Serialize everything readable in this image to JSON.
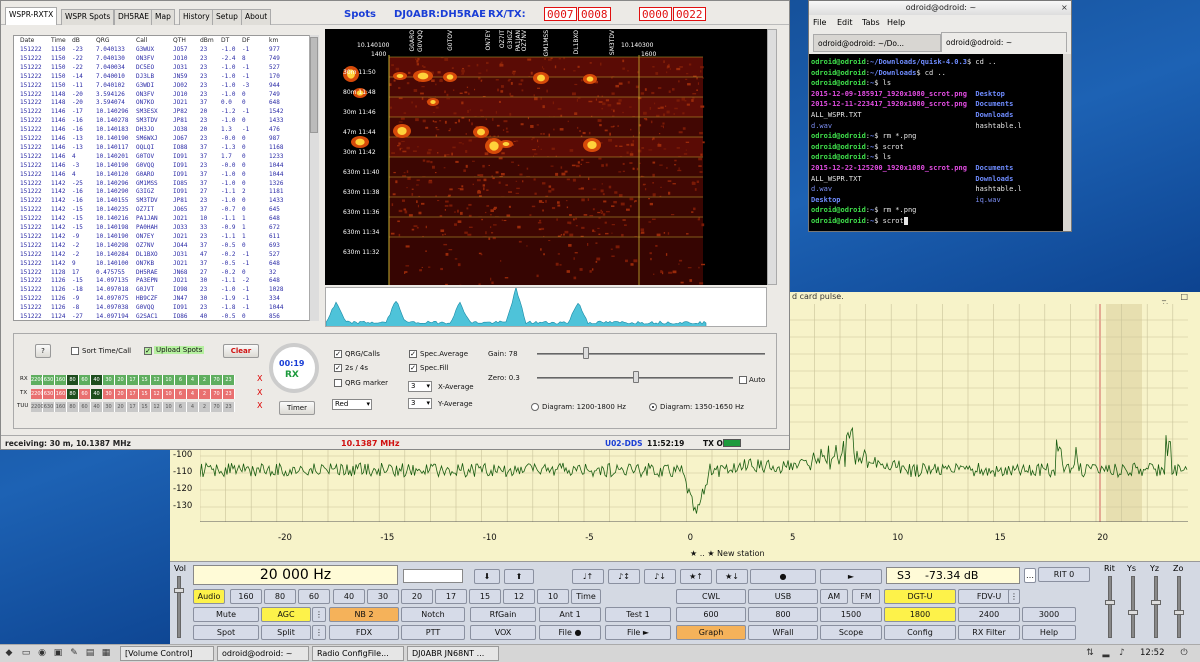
{
  "wspr": {
    "tabs": [
      "WSPR-RXTX",
      "WSPR Spots",
      "DH5RAE",
      "Map",
      "History",
      "Setup",
      "About"
    ],
    "spots_title": "Spots",
    "call_title": "DJ0ABR:DH5RAE",
    "rxtx_label": "RX/TX:",
    "rxtx_counter": [
      "0007",
      "0008"
    ],
    "time_counter": [
      "0000",
      "0022"
    ],
    "table_headers": [
      "Date",
      "Time",
      "dB",
      "QRG",
      "Call",
      "QTH",
      "dBm",
      "DT",
      "DF",
      "km"
    ],
    "rows": [
      [
        "151222",
        "1150",
        "-23",
        "7.040133",
        "G3WUX",
        "JO57",
        "23",
        "-1.0",
        "-1",
        "977"
      ],
      [
        "151222",
        "1150",
        "-22",
        "7.040130",
        "ON3FV",
        "JO10",
        "23",
        "-2.4",
        "8",
        "749"
      ],
      [
        "151222",
        "1150",
        "-22",
        "7.040034",
        "DC5EO",
        "JO31",
        "23",
        "-1.0",
        "-1",
        "527"
      ],
      [
        "151222",
        "1150",
        "-14",
        "7.040010",
        "DJ3LB",
        "JN59",
        "23",
        "-1.0",
        "-1",
        "170"
      ],
      [
        "151222",
        "1150",
        "-11",
        "7.040102",
        "G3WDI",
        "JO02",
        "23",
        "-1.0",
        "-3",
        "944"
      ],
      [
        "151222",
        "1148",
        "-20",
        "3.594126",
        "ON3FV",
        "JO10",
        "23",
        "-1.0",
        "0",
        "749"
      ],
      [
        "151222",
        "1148",
        "-20",
        "3.594074",
        "ON7KO",
        "JO21",
        "37",
        "0.0",
        "0",
        "648"
      ],
      [
        "151222",
        "1146",
        "-17",
        "10.140296",
        "SM3ESX",
        "JP82",
        "20",
        "-1.2",
        "-1",
        "1542"
      ],
      [
        "151222",
        "1146",
        "-16",
        "10.140278",
        "SM3TDV",
        "JP81",
        "23",
        "-1.0",
        "0",
        "1433"
      ],
      [
        "151222",
        "1146",
        "-16",
        "10.140183",
        "DH3JO",
        "JO38",
        "20",
        "1.3",
        "-1",
        "476"
      ],
      [
        "151222",
        "1146",
        "-13",
        "10.140190",
        "SM6WXJ",
        "JO67",
        "23",
        "-0.0",
        "0",
        "987"
      ],
      [
        "151222",
        "1146",
        "-13",
        "10.140117",
        "OQLQI",
        "IO88",
        "37",
        "-1.3",
        "0",
        "1168"
      ],
      [
        "151222",
        "1146",
        "4",
        "10.140201",
        "G0TOV",
        "IO91",
        "37",
        "1.7",
        "0",
        "1233"
      ],
      [
        "151222",
        "1146",
        "-3",
        "10.140190",
        "G0VQQ",
        "IO91",
        "23",
        "-0.0",
        "0",
        "1044"
      ],
      [
        "151222",
        "1146",
        "4",
        "10.140120",
        "G0ARO",
        "IO91",
        "37",
        "-1.0",
        "0",
        "1044"
      ],
      [
        "151222",
        "1142",
        "-25",
        "10.140296",
        "GM1MSS",
        "IO85",
        "37",
        "-1.0",
        "0",
        "1326"
      ],
      [
        "151222",
        "1142",
        "-16",
        "10.140290",
        "G3IGZ",
        "IO91",
        "27",
        "-1.1",
        "2",
        "1181"
      ],
      [
        "151222",
        "1142",
        "-16",
        "10.140155",
        "SM3TDV",
        "JP81",
        "23",
        "-1.0",
        "0",
        "1433"
      ],
      [
        "151222",
        "1142",
        "-15",
        "10.140235",
        "OZ7IT",
        "JO65",
        "37",
        "-0.7",
        "0",
        "645"
      ],
      [
        "151222",
        "1142",
        "-15",
        "10.140216",
        "PA1JAN",
        "JO21",
        "10",
        "-1.1",
        "1",
        "648"
      ],
      [
        "151222",
        "1142",
        "-15",
        "10.140198",
        "PA0HAH",
        "JO33",
        "33",
        "-0.9",
        "1",
        "672"
      ],
      [
        "151222",
        "1142",
        "-9",
        "10.140190",
        "ON7EY",
        "JO21",
        "23",
        "-1.1",
        "1",
        "611"
      ],
      [
        "151222",
        "1142",
        "-2",
        "10.140298",
        "OZ7NV",
        "JO44",
        "37",
        "-0.5",
        "0",
        "693"
      ],
      [
        "151222",
        "1142",
        "-2",
        "10.140284",
        "DL1BXO",
        "JO31",
        "47",
        "-0.2",
        "-1",
        "527"
      ],
      [
        "151222",
        "1142",
        "9",
        "10.140100",
        "ON7KB",
        "JO21",
        "37",
        "-0.5",
        "-1",
        "648"
      ],
      [
        "151222",
        "1128",
        "17",
        "0.475755",
        "DH5RAE",
        "JN68",
        "27",
        "-0.2",
        "0",
        "32"
      ],
      [
        "151222",
        "1126",
        "-15",
        "14.097135",
        "PA3EPN",
        "JO21",
        "30",
        "-1.1",
        "-2",
        "648"
      ],
      [
        "151222",
        "1126",
        "-18",
        "14.097018",
        "G0JVT",
        "IO98",
        "23",
        "-1.0",
        "-1",
        "1028"
      ],
      [
        "151222",
        "1126",
        "-9",
        "14.097075",
        "HB9CZF",
        "JN47",
        "30",
        "-1.9",
        "-1",
        "334"
      ],
      [
        "151222",
        "1126",
        "-8",
        "14.097038",
        "G0VQQ",
        "IO91",
        "23",
        "-1.8",
        "-1",
        "1044"
      ],
      [
        "151222",
        "1124",
        "-27",
        "14.097194",
        "G2SAC1",
        "IO86",
        "40",
        "-0.5",
        "0",
        "856"
      ]
    ],
    "waterfall": {
      "freq_left": "10.140100",
      "freq_left_sub": "1400",
      "freq_right": "10.140300",
      "freq_right_sub": "1600",
      "calls": [
        "G0ARO",
        "G0VQQ",
        "G0TOV",
        "ON7EY",
        "OZ7IT",
        "G3IGZ",
        "PA1JAN",
        "OZ7NV",
        "GM1MSS",
        "DL1BXO",
        "SM3TDV"
      ],
      "time_labels": [
        "30m 11:50",
        "80m 11:48",
        "30m 11:46",
        "47m 11:44",
        "30m 11:42",
        "630m 11:40",
        "630m 11:38",
        "630m 11:36",
        "630m 11:34",
        "630m 11:32"
      ]
    },
    "controls": {
      "help_btn": "?",
      "sort_label": "Sort Time/Call",
      "upload_label": "Upload Spots",
      "clear_btn": "Clear",
      "rx_label": "RX",
      "tx_label": "TX",
      "tuu_label": "TUU",
      "bands": [
        "2200",
        "630",
        "160",
        "80",
        "60",
        "40",
        "30",
        "20",
        "17",
        "15",
        "12",
        "10",
        "6",
        "4",
        "2",
        "70",
        "23"
      ],
      "dial_time": "00:19",
      "dial_mode": "RX",
      "timer_btn": "Timer",
      "qrg_calls": "QRG/Calls",
      "twos_fours": "2s / 4s",
      "qrg_marker": "QRG marker",
      "color_select": "Red",
      "spec_average": "Spec.Average",
      "spec_fill": "Spec.Fill",
      "x_average_val": "3",
      "x_average": "X-Average",
      "y_average_val": "3",
      "y_average": "Y-Average",
      "gain_label": "Gain: 78",
      "zero_label": "Zero: 0.3",
      "auto_label": "Auto",
      "diag1": "Diagram: 1200-1800 Hz",
      "diag2": "Diagram: 1350-1650 Hz"
    },
    "status": {
      "receiving": "receiving: 30 m, 10.1387 MHz",
      "freq": "10.1387 MHz",
      "dds": "U02-DDS",
      "time": "11:52:19",
      "tx": "TX OFF"
    }
  },
  "terminal": {
    "title": "odroid@odroid: ~",
    "menu": [
      "File",
      "Edit",
      "Tabs",
      "Help"
    ],
    "tab1": "odroid@odroid: ~/Do...",
    "tab2": "odroid@odroid: ~",
    "lines": [
      [
        [
          "c-green",
          "odroid@odroid"
        ],
        [
          "c-white",
          ":"
        ],
        [
          "c-blue",
          "~/Downloads/quisk-4.0.3"
        ],
        [
          "c-white",
          "$ cd .."
        ]
      ],
      [
        [
          "c-green",
          "odroid@odroid"
        ],
        [
          "c-white",
          ":"
        ],
        [
          "c-blue",
          "~/Downloads"
        ],
        [
          "c-white",
          "$ cd .."
        ]
      ],
      [
        [
          "c-green",
          "odroid@odroid"
        ],
        [
          "c-white",
          ":"
        ],
        [
          "c-blue",
          "~"
        ],
        [
          "c-white",
          "$ ls"
        ]
      ],
      [
        [
          "c-mag",
          "2015-12-09-185917_1920x1080_scrot.png"
        ],
        [
          "c-blue",
          "  Desktop"
        ]
      ],
      [
        [
          "c-mag",
          "2015-12-11-223417_1920x1080_scrot.png"
        ],
        [
          "c-blue",
          "  Documents"
        ]
      ],
      [
        [
          "c-white",
          "ALL_WSPR.TXT                           "
        ],
        [
          "c-blue",
          "Downloads"
        ]
      ],
      [
        [
          "c-lblue",
          "d.wav                                  "
        ],
        [
          "c-white",
          "hashtable.l"
        ]
      ],
      [
        [
          "c-green",
          "odroid@odroid"
        ],
        [
          "c-white",
          ":"
        ],
        [
          "c-blue",
          "~"
        ],
        [
          "c-white",
          "$ rm *.png"
        ]
      ],
      [
        [
          "c-green",
          "odroid@odroid"
        ],
        [
          "c-white",
          ":"
        ],
        [
          "c-blue",
          "~"
        ],
        [
          "c-white",
          "$ scrot"
        ]
      ],
      [
        [
          "c-green",
          "odroid@odroid"
        ],
        [
          "c-white",
          ":"
        ],
        [
          "c-blue",
          "~"
        ],
        [
          "c-white",
          "$ ls"
        ]
      ],
      [
        [
          "c-mag",
          "2015-12-22-125200_1920x1080_scrot.png"
        ],
        [
          "c-blue",
          "  Documents"
        ]
      ],
      [
        [
          "c-white",
          "ALL_WSPR.TXT                           "
        ],
        [
          "c-blue",
          "Downloads"
        ]
      ],
      [
        [
          "c-lblue",
          "d.wav                                  "
        ],
        [
          "c-white",
          "hashtable.l"
        ]
      ],
      [
        [
          "c-blue",
          "Desktop                                "
        ],
        [
          "c-lblue",
          "iq.wav"
        ]
      ],
      [
        [
          "c-green",
          "odroid@odroid"
        ],
        [
          "c-white",
          ":"
        ],
        [
          "c-blue",
          "~"
        ],
        [
          "c-white",
          "$ rm *.png"
        ]
      ],
      [
        [
          "c-green",
          "odroid@odroid"
        ],
        [
          "c-white",
          ":"
        ],
        [
          "c-blue",
          "~"
        ],
        [
          "c-white",
          "$ scrot"
        ]
      ]
    ]
  },
  "quisk": {
    "title": "d card pulse.",
    "window_controls": "_ □ ×",
    "y_labels": [
      "-100",
      "-110",
      "-120",
      "-130"
    ],
    "x_labels": [
      "-20",
      "-15",
      "-10",
      "-5",
      "0",
      "5",
      "10",
      "15",
      "20"
    ],
    "new_station": "★ ..  ★ New station",
    "vol_label": "Vol",
    "freq_display": "20 000 Hz",
    "smeter": "S3    -73.34 dB",
    "rit": "RIT 0",
    "row1": [
      "Audio",
      "160",
      "80",
      "60",
      "40",
      "30",
      "20",
      "17",
      "15",
      "12",
      "10",
      "Time"
    ],
    "row1_ctrl": [
      "♩↑",
      "♪↕",
      "♪↓",
      "★↑",
      "★↓",
      "●",
      "►"
    ],
    "row1_right": [
      "CWL",
      "USB",
      "AM",
      "FM",
      "DGT-U",
      "FDV-U"
    ],
    "row2": [
      "Mute",
      "AGC",
      "NB 2",
      "Notch",
      "RfGain",
      "Ant 1",
      "Test 1",
      "600",
      "800",
      "1500",
      "1800",
      "2400",
      "3000"
    ],
    "row3": [
      "Spot",
      "Split",
      "FDX",
      "PTT",
      "VOX",
      "File ●",
      "File ►",
      "Graph",
      "WFall",
      "Scope",
      "Config",
      "RX Filter",
      "Help"
    ],
    "right_labels": [
      "Rit",
      "Ys",
      "Yz",
      "Zo"
    ]
  },
  "taskbar": {
    "items": [
      "[Volume Control]",
      "odroid@odroid: ~",
      "Radio ConfigFile...",
      "DJ0ABR JN68NT ..."
    ],
    "clock": "12:52"
  }
}
